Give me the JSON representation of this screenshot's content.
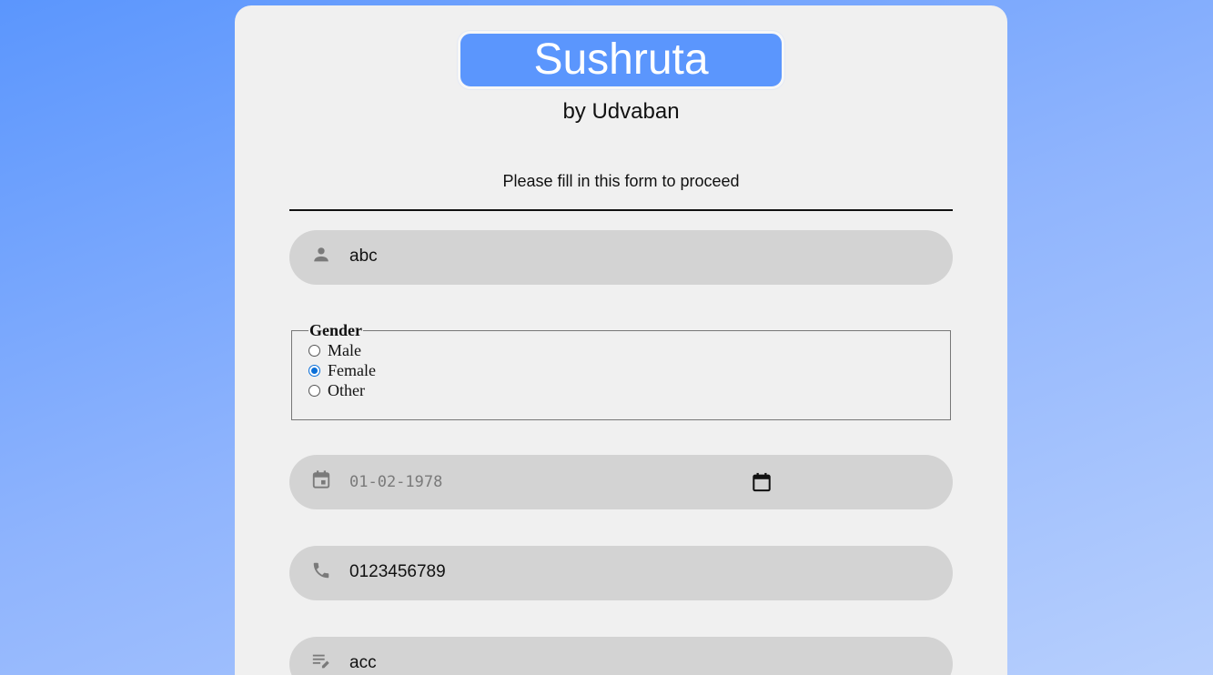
{
  "brand": {
    "title": "Sushruta",
    "subtitle": "by Udvaban",
    "accent_color": "#5b96fd"
  },
  "form": {
    "instruction": "Please fill in this form to proceed",
    "name_field": {
      "icon": "person-icon",
      "value": "abc"
    },
    "gender": {
      "legend": "Gender",
      "options": [
        {
          "label": "Male",
          "checked": false
        },
        {
          "label": "Female",
          "checked": true
        },
        {
          "label": "Other",
          "checked": false
        }
      ]
    },
    "dob_field": {
      "icon": "calendar-icon",
      "value": "01-02-1978",
      "picker_icon": "calendar-picker-icon"
    },
    "phone_field": {
      "icon": "phone-icon",
      "value": "0123456789"
    },
    "notes_field": {
      "icon": "notes-edit-icon",
      "value": "acc"
    }
  }
}
